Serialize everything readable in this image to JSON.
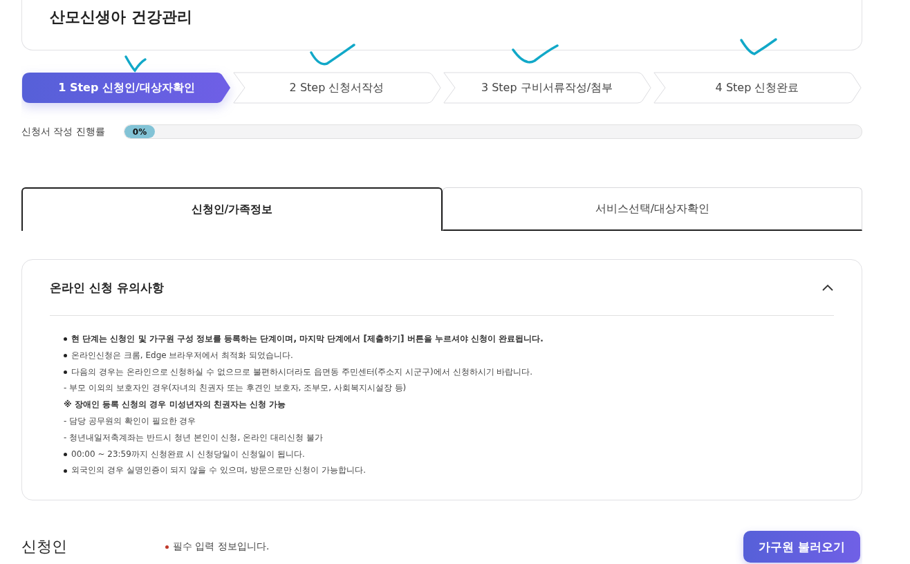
{
  "header": {
    "title": "산모신생아 건강관리"
  },
  "steps": [
    {
      "label": "1 Step 신청인/대상자확인",
      "selected": true
    },
    {
      "label": "2 Step 신청서작성",
      "selected": false
    },
    {
      "label": "3 Step 구비서류작성/첨부",
      "selected": false
    },
    {
      "label": "4 Step 신청완료",
      "selected": false
    }
  ],
  "progress": {
    "label": "신청서 작성 진행률",
    "level": 0,
    "reading": "0%"
  },
  "tabs": [
    {
      "label": "신청인/가족정보",
      "selected": true
    },
    {
      "label": "서비스선택/대상자확인",
      "selected": false
    }
  ],
  "notice": {
    "title": "온라인 신청 유의사항",
    "expanded": true,
    "items": [
      {
        "kind": "bullet",
        "emphasis": true,
        "text": "현 단계는 신청인 및 가구원 구성 정보를 등록하는 단계이며, 마지막 단계에서 [제출하기] 버튼을 누르셔야 신청이 완료됩니다."
      },
      {
        "kind": "bullet",
        "emphasis": false,
        "text": "온라인신청은 크롬, Edge 브라우저에서 최적화 되었습니다."
      },
      {
        "kind": "bullet",
        "emphasis": false,
        "text": "다음의 경우는 온라인으로 신청하실 수 없으므로 불편하시더라도 읍면동 주민센터(주소지 시군구)에서 신청하시기 바랍니다."
      },
      {
        "kind": "dash",
        "emphasis": false,
        "text": "- 부모 이외의 보호자인 경우(자녀의 친권자 또는 후견인 보호자, 조부모, 사회복지시설장 등)"
      },
      {
        "kind": "note",
        "emphasis": true,
        "text": "※ 장애인 등록 신청의 경우 미성년자의 친권자는 신청 가능"
      },
      {
        "kind": "dash",
        "emphasis": false,
        "text": "- 담당 공무원의 확인이 필요한 경우"
      },
      {
        "kind": "dash",
        "emphasis": false,
        "text": "- 청년내일저축계좌는 반드시 청년 본인이 신청, 온라인 대리신청 불가"
      },
      {
        "kind": "bullet",
        "emphasis": false,
        "text": "00:00 ~ 23:59까지 신청완료 시 신청당일이 신청일이 됩니다."
      },
      {
        "kind": "bullet",
        "emphasis": false,
        "text": "외국인의 경우 실명인증이 되지 않을 수 있으며, 방문으로만 신청이 가능합니다."
      }
    ]
  },
  "applicant": {
    "title": "신청인",
    "hint": "필수 입력 정보입니다.",
    "button": "가구원 불러오기"
  }
}
